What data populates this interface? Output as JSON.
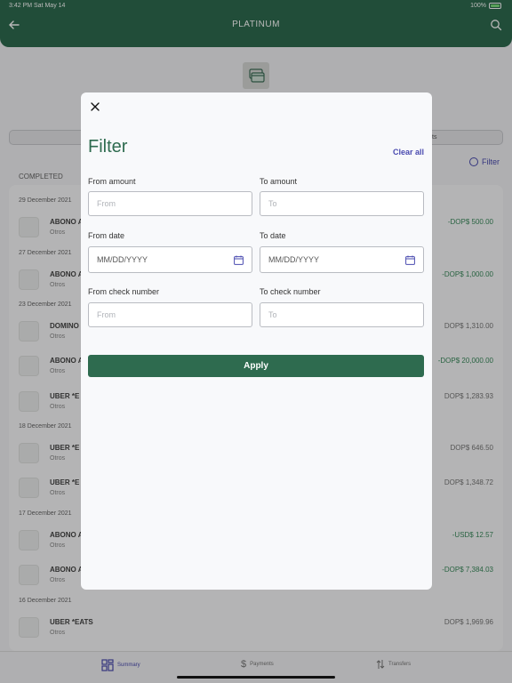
{
  "status": {
    "time": "3:42 PM  Sat May 14",
    "battery": "100%"
  },
  "header": {
    "title": "PLATINUM"
  },
  "segment": {
    "right_label": "ts"
  },
  "filter_link": "Filter",
  "section": "COMPLETED",
  "groups": [
    {
      "date": "29 December 2021"
    },
    {
      "date": "27 December 2021"
    },
    {
      "date": "23 December 2021"
    },
    {
      "date": "18 December 2021"
    },
    {
      "date": "17 December 2021"
    },
    {
      "date": "16 December 2021"
    }
  ],
  "transactions": [
    {
      "title": "ABONO A",
      "sub": "Otros",
      "amount": "-DOP$ 500.00"
    },
    {
      "title": "ABONO A",
      "sub": "Otros",
      "amount": "-DOP$ 1,000.00"
    },
    {
      "title": "DOMINO",
      "sub": "Otros",
      "amount": "DOP$ 1,310.00"
    },
    {
      "title": "ABONO A",
      "sub": "Otros",
      "amount": "-DOP$ 20,000.00"
    },
    {
      "title": "UBER   *E",
      "sub": "Otros",
      "amount": "DOP$ 1,283.93"
    },
    {
      "title": "UBER   *E",
      "sub": "Otros",
      "amount": "DOP$ 646.50"
    },
    {
      "title": "UBER   *E",
      "sub": "Otros",
      "amount": "DOP$ 1,348.72"
    },
    {
      "title": "ABONO A",
      "sub": "Otros",
      "amount": "-USD$ 12.57"
    },
    {
      "title": "ABONO A",
      "sub": "Otros",
      "amount": "-DOP$ 7,384.03"
    },
    {
      "title": "UBER   *EATS",
      "sub": "Otros",
      "amount": "DOP$ 1,969.96"
    }
  ],
  "tabs": {
    "summary": "Summary",
    "payments": "Payments",
    "transfers": "Transfers"
  },
  "modal": {
    "title": "Filter",
    "clear_all": "Clear all",
    "from_amount_label": "From amount",
    "from_amount_placeholder": "From",
    "to_amount_label": "To amount",
    "to_amount_placeholder": "To",
    "from_date_label": "From date",
    "from_date_value": "MM/DD/YYYY",
    "to_date_label": "To date",
    "to_date_value": "MM/DD/YYYY",
    "from_check_label": "From check number",
    "from_check_placeholder": "From",
    "to_check_label": "To check number",
    "to_check_placeholder": "To",
    "apply": "Apply"
  },
  "colors": {
    "brand": "#2e6b4f",
    "accent": "#4a4bb0",
    "positive": "#3a8a5c"
  }
}
